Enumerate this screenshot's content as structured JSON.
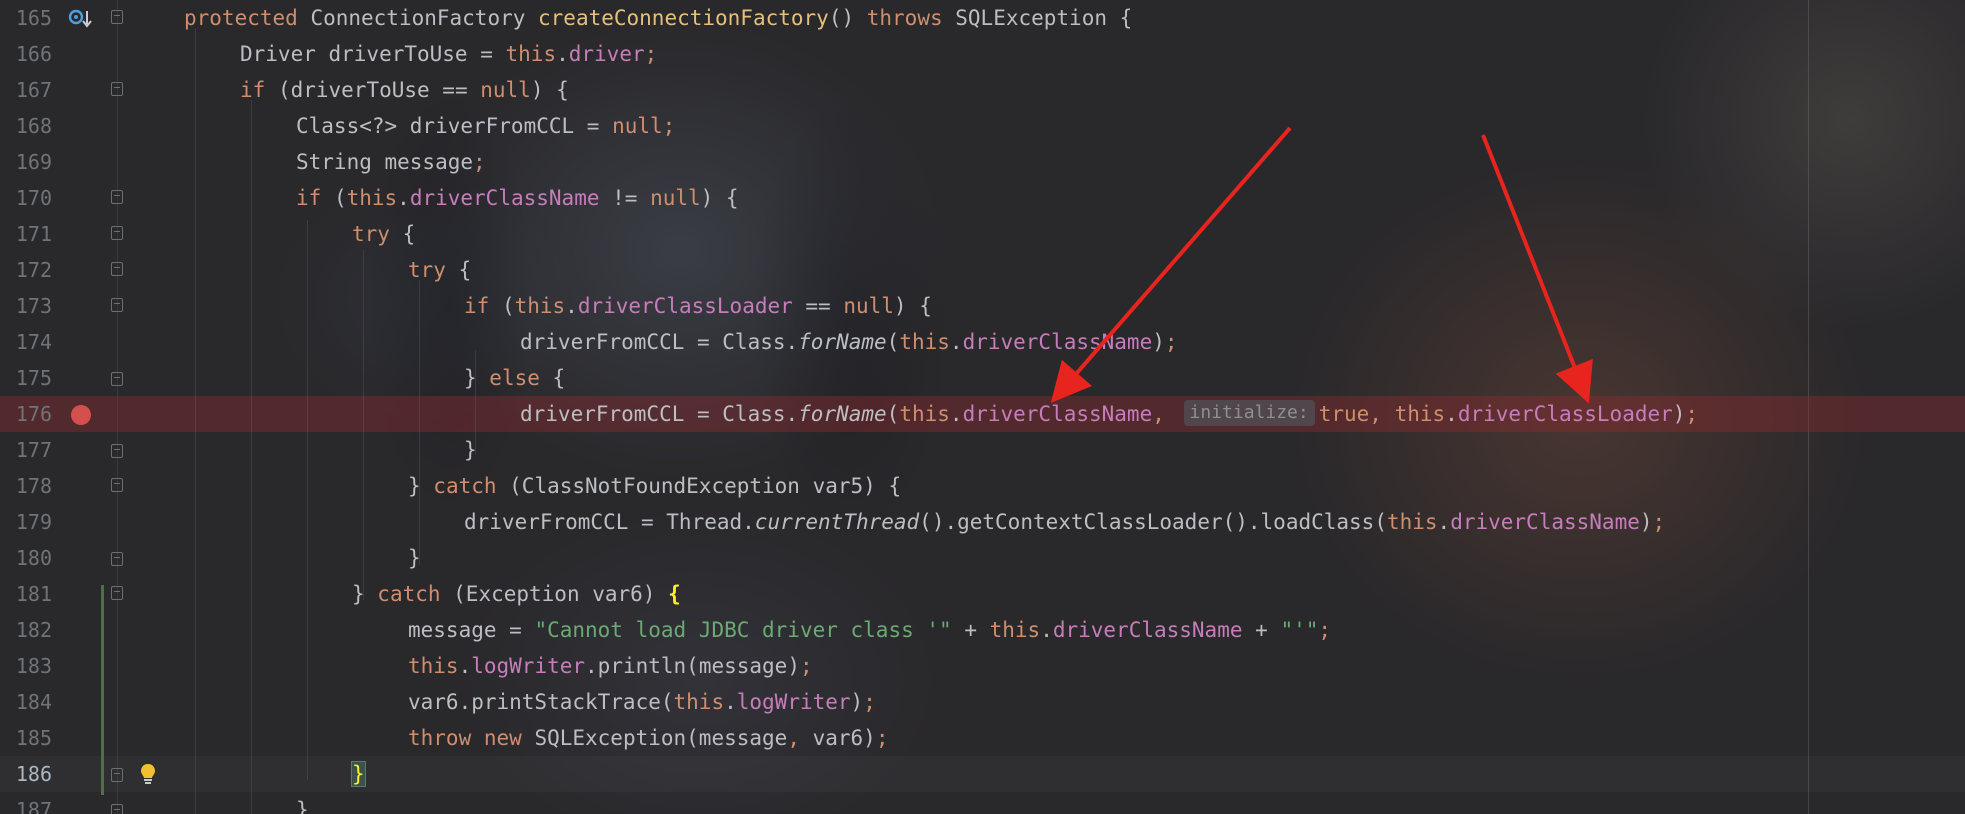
{
  "editor": {
    "lines": [
      {
        "number": "165",
        "tokens": [
          [
            "kw",
            "protected "
          ],
          [
            "",
            "ConnectionFactory "
          ],
          [
            "fnd",
            "createConnectionFactory"
          ],
          [
            "",
            "() "
          ],
          [
            "kw",
            "throws "
          ],
          [
            "",
            "SQLException {"
          ]
        ]
      },
      {
        "number": "166",
        "tokens": [
          [
            "",
            "Driver driverToUse = "
          ],
          [
            "kw",
            "this"
          ],
          [
            "",
            "."
          ],
          [
            "fld",
            "driver"
          ],
          [
            "kw",
            ";"
          ]
        ]
      },
      {
        "number": "167",
        "tokens": [
          [
            "kw",
            "if "
          ],
          [
            "",
            "(driverToUse == "
          ],
          [
            "kw",
            "null"
          ],
          [
            "",
            ") {"
          ]
        ]
      },
      {
        "number": "168",
        "tokens": [
          [
            "",
            "Class<?> driverFromCCL = "
          ],
          [
            "kw",
            "null"
          ],
          [
            "kw",
            ";"
          ]
        ]
      },
      {
        "number": "169",
        "tokens": [
          [
            "",
            "String message"
          ],
          [
            "kw",
            ";"
          ]
        ]
      },
      {
        "number": "170",
        "tokens": [
          [
            "kw",
            "if "
          ],
          [
            "",
            "("
          ],
          [
            "kw",
            "this"
          ],
          [
            "",
            "."
          ],
          [
            "fld",
            "driverClassName"
          ],
          [
            "",
            " != "
          ],
          [
            "kw",
            "null"
          ],
          [
            "",
            ") {"
          ]
        ]
      },
      {
        "number": "171",
        "tokens": [
          [
            "kw",
            "try "
          ],
          [
            "",
            "{"
          ]
        ]
      },
      {
        "number": "172",
        "tokens": [
          [
            "kw",
            "try "
          ],
          [
            "",
            "{"
          ]
        ]
      },
      {
        "number": "173",
        "tokens": [
          [
            "kw",
            "if "
          ],
          [
            "",
            "("
          ],
          [
            "kw",
            "this"
          ],
          [
            "",
            "."
          ],
          [
            "fld",
            "driverClassLoader"
          ],
          [
            "",
            " == "
          ],
          [
            "kw",
            "null"
          ],
          [
            "",
            ") {"
          ]
        ]
      },
      {
        "number": "174",
        "tokens": [
          [
            "",
            "driverFromCCL = Class."
          ],
          [
            "it",
            "forName"
          ],
          [
            "",
            "("
          ],
          [
            "kw",
            "this"
          ],
          [
            "",
            "."
          ],
          [
            "fld",
            "driverClassName"
          ],
          [
            "",
            ")"
          ],
          [
            "kw",
            ";"
          ]
        ]
      },
      {
        "number": "175",
        "tokens": [
          [
            "",
            "} "
          ],
          [
            "kw",
            "else "
          ],
          [
            "",
            "{"
          ]
        ]
      },
      {
        "number": "176",
        "tokens": [
          [
            "",
            "driverFromCCL = Class."
          ],
          [
            "it",
            "forName"
          ],
          [
            "",
            "("
          ],
          [
            "kw",
            "this"
          ],
          [
            "",
            "."
          ],
          [
            "fld",
            "driverClassName"
          ],
          [
            "kw",
            ", "
          ],
          [
            "hint",
            "initialize:"
          ],
          [
            "kw",
            "true, "
          ],
          [
            "kw",
            "this"
          ],
          [
            "",
            "."
          ],
          [
            "fld",
            "driverClassLoader"
          ],
          [
            "",
            ")"
          ],
          [
            "kw",
            ";"
          ]
        ]
      },
      {
        "number": "177",
        "tokens": [
          [
            "",
            "}"
          ]
        ]
      },
      {
        "number": "178",
        "tokens": [
          [
            "",
            "} "
          ],
          [
            "kw",
            "catch "
          ],
          [
            "",
            "(ClassNotFoundException var5) {"
          ]
        ]
      },
      {
        "number": "179",
        "tokens": [
          [
            "",
            "driverFromCCL = Thread."
          ],
          [
            "it",
            "currentThread"
          ],
          [
            "",
            "().getContextClassLoader().loadClass("
          ],
          [
            "kw",
            "this"
          ],
          [
            "",
            "."
          ],
          [
            "fld",
            "driverClassName"
          ],
          [
            "",
            ")"
          ],
          [
            "kw",
            ";"
          ]
        ]
      },
      {
        "number": "180",
        "tokens": [
          [
            "",
            "}"
          ]
        ]
      },
      {
        "number": "181",
        "tokens": [
          [
            "",
            "} "
          ],
          [
            "kw",
            "catch "
          ],
          [
            "",
            "(Exception var6) "
          ],
          [
            "brace-yellow",
            "{"
          ]
        ]
      },
      {
        "number": "182",
        "tokens": [
          [
            "",
            "message = "
          ],
          [
            "str",
            "\"Cannot load JDBC driver class '\""
          ],
          [
            "",
            " + "
          ],
          [
            "kw",
            "this"
          ],
          [
            "",
            "."
          ],
          [
            "fld",
            "driverClassName"
          ],
          [
            "",
            " + "
          ],
          [
            "str",
            "\"'\""
          ],
          [
            "kw",
            ";"
          ]
        ]
      },
      {
        "number": "183",
        "tokens": [
          [
            "kw",
            "this"
          ],
          [
            "",
            "."
          ],
          [
            "fld",
            "logWriter"
          ],
          [
            "",
            ".println(message)"
          ],
          [
            "kw",
            ";"
          ]
        ]
      },
      {
        "number": "184",
        "tokens": [
          [
            "",
            "var6.printStackTrace("
          ],
          [
            "kw",
            "this"
          ],
          [
            "",
            "."
          ],
          [
            "fld",
            "logWriter"
          ],
          [
            "",
            ")"
          ],
          [
            "kw",
            ";"
          ]
        ]
      },
      {
        "number": "185",
        "tokens": [
          [
            "kw",
            "throw new "
          ],
          [
            "",
            "SQLException(message"
          ],
          [
            "kw",
            ", "
          ],
          [
            "",
            "var6)"
          ],
          [
            "kw",
            ";"
          ]
        ]
      },
      {
        "number": "186",
        "tokens": [
          [
            "brace-match",
            "}"
          ]
        ]
      },
      {
        "number": "187",
        "tokens": [
          [
            "",
            "}"
          ]
        ]
      }
    ]
  },
  "colors": {
    "keyword": "#cf8e6d",
    "field": "#c77dbb",
    "method_decl": "#e6c07b",
    "string": "#6aab73",
    "plain": "#bcbec4",
    "line_number": "#6f737a",
    "breakpoint": "#d4504f",
    "annotation_arrow": "#e8241e"
  },
  "icons": {
    "override": "override-gutter-icon",
    "breakpoint": "breakpoint-icon",
    "intention": "lightbulb-icon"
  }
}
